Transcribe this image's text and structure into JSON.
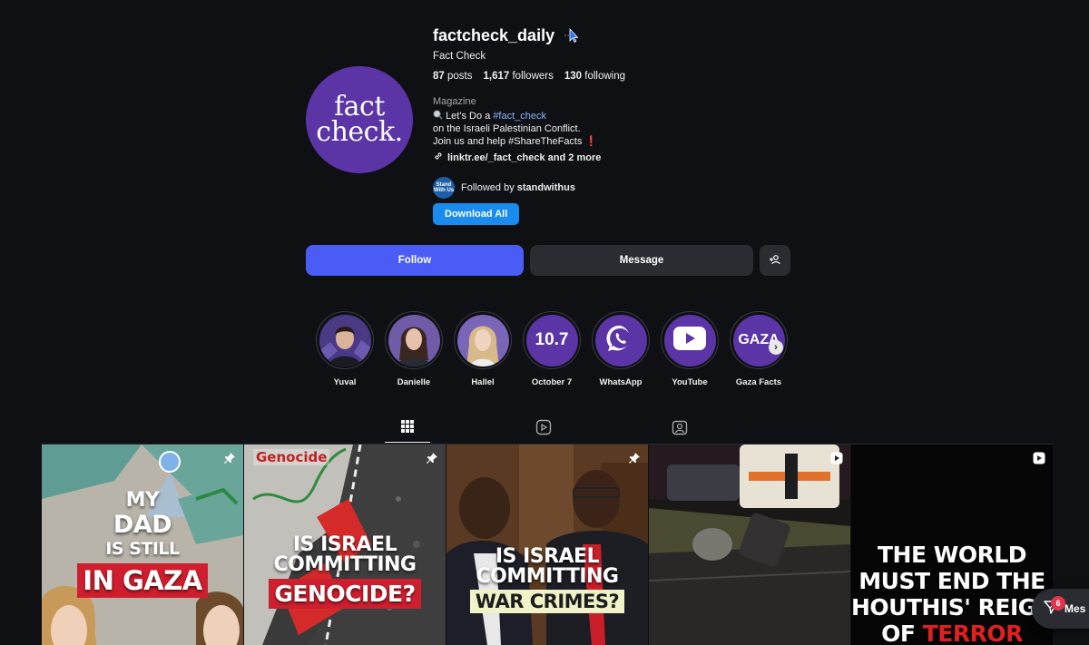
{
  "profile": {
    "avatar_line1": "fact",
    "avatar_line2": "check.",
    "username": "factcheck_daily",
    "full_name": "Fact Check",
    "stats": {
      "posts_count": "87",
      "posts_label": "posts",
      "followers_count": "1,617",
      "followers_label": "followers",
      "following_count": "130",
      "following_label": "following"
    },
    "category": "Magazine",
    "bio": {
      "line1_prefix": "Let's Do a ",
      "line1_tag": "#fact_check",
      "line2": "on the Israeli Palestinian Conflict.",
      "line3": "Join us and help #ShareTheFacts",
      "line3_mark": "❗"
    },
    "link": "linktr.ee/_fact_check and 2 more",
    "followed_by_avatar": "Stand With Us",
    "followed_by_prefix": "Followed by ",
    "followed_by_name": "standwithus",
    "download_label": "Download All"
  },
  "actions": {
    "follow_label": "Follow",
    "message_label": "Message"
  },
  "highlights": [
    {
      "label": "Yuval",
      "type": "person"
    },
    {
      "label": "Danielle",
      "type": "person"
    },
    {
      "label": "Hallel",
      "type": "person"
    },
    {
      "label": "October 7",
      "type": "text",
      "text": "10.7"
    },
    {
      "label": "WhatsApp",
      "type": "icon",
      "icon": "whatsapp-icon"
    },
    {
      "label": "YouTube",
      "type": "icon",
      "icon": "youtube-icon"
    },
    {
      "label": "Gaza Facts",
      "type": "text",
      "text": "GAZA"
    }
  ],
  "tabs": [
    "posts-grid-icon",
    "reels-icon",
    "tagged-icon"
  ],
  "posts": [
    {
      "lines": [
        "MY",
        "DAD",
        "IS STILL"
      ],
      "boxed": "IN GAZA",
      "icon": "pin-icon"
    },
    {
      "corner_label": "Genocide",
      "lines": [
        "IS ISRAEL",
        "COMMITTING"
      ],
      "boxed": "GENOCIDE?",
      "icon": "pin-icon"
    },
    {
      "lines": [
        "IS ISRAEL",
        "COMMITTING"
      ],
      "boxed": "WAR CRIMES?",
      "icon": "pin-icon"
    },
    {
      "icon": "reel-icon"
    },
    {
      "lines": [
        "THE WORLD",
        "MUST END THE",
        "HOUTHIS' REIGN"
      ],
      "last_prefix": "OF ",
      "last_red": "TERROR",
      "icon": "reel-icon"
    }
  ],
  "messages": {
    "badge": "6",
    "label": "Mes"
  },
  "colors": {
    "background": "#0f1014",
    "follow": "#4a5cf5",
    "download": "#1a8cf0",
    "avatar": "#5b34a6",
    "hashtag": "#8ab4ff"
  }
}
